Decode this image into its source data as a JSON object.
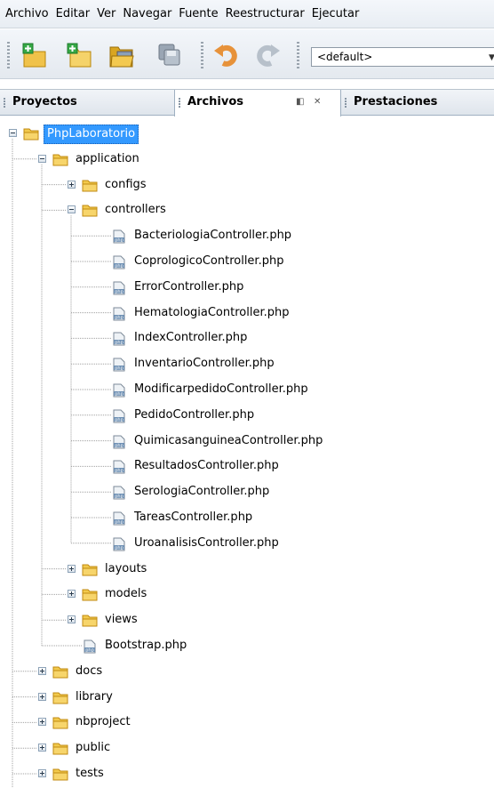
{
  "menubar": {
    "items": [
      "Archivo",
      "Editar",
      "Ver",
      "Navegar",
      "Fuente",
      "Reestructurar",
      "Ejecutar"
    ]
  },
  "toolbar": {
    "buttons": [
      "new-project-icon",
      "new-file-icon",
      "open-project-icon",
      "save-all-icon",
      "undo-icon",
      "redo-icon"
    ],
    "config_select": "<default>"
  },
  "tabs": {
    "proyectos": "Proyectos",
    "archivos": "Archivos",
    "prestaciones": "Prestaciones"
  },
  "tree": {
    "root": "PhpLaboratorio",
    "application": "application",
    "configs": "configs",
    "controllers_folder": "controllers",
    "controllers": [
      "BacteriologiaController.php",
      "CoprologicoController.php",
      "ErrorController.php",
      "HematologiaController.php",
      "IndexController.php",
      "InventarioController.php",
      "ModificarpedidoController.php",
      "PedidoController.php",
      "QuimicasanguineaController.php",
      "ResultadosController.php",
      "SerologiaController.php",
      "TareasController.php",
      "UroanalisisController.php"
    ],
    "layouts": "layouts",
    "models": "models",
    "views": "views",
    "bootstrap": "Bootstrap.php",
    "docs": "docs",
    "library": "library",
    "nbproject": "nbproject",
    "public": "public",
    "tests": "tests"
  },
  "colors": {
    "selection": "#3399ff",
    "folder": "#e8b52c"
  }
}
